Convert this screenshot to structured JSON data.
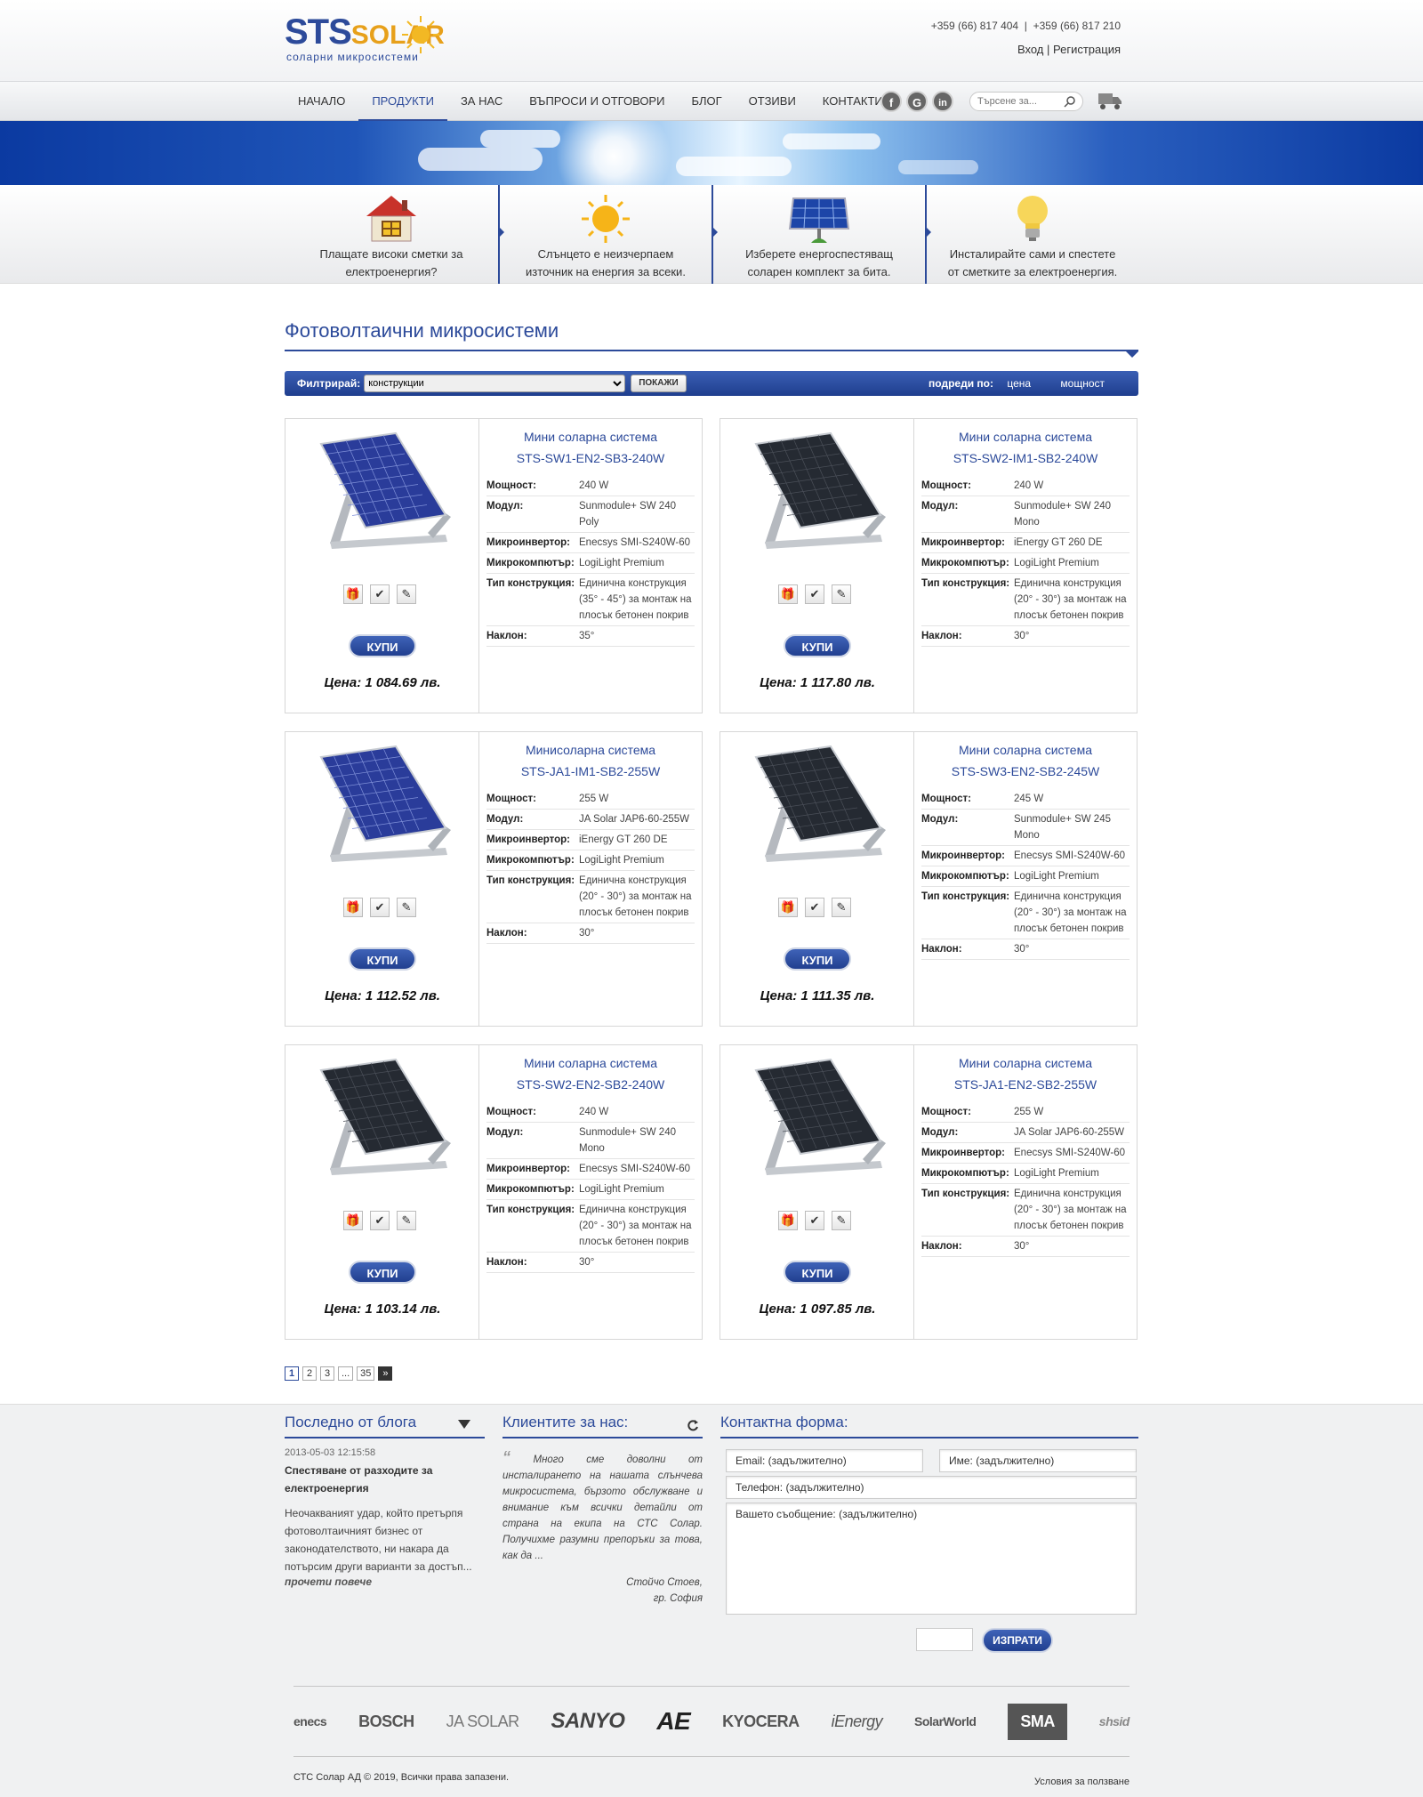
{
  "header": {
    "logo_main": "STS",
    "logo_accent": "SOLAR",
    "logo_sub": "соларни микросистеми",
    "phone1": "+359 (66) 817 404",
    "phone_sep": "|",
    "phone2": "+359 (66) 817 210",
    "login": "Вход",
    "auth_sep": "|",
    "register": "Регистрация"
  },
  "nav": {
    "items": [
      {
        "label": "НАЧАЛО"
      },
      {
        "label": "ПРОДУКТИ"
      },
      {
        "label": "ЗА НАС"
      },
      {
        "label": "ВЪПРОСИ И ОТГОВОРИ"
      },
      {
        "label": "БЛОГ"
      },
      {
        "label": "ОТЗИВИ"
      },
      {
        "label": "КОНТАКТИ"
      }
    ],
    "active_index": 1,
    "social": [
      "f",
      "G",
      "in"
    ],
    "search_placeholder": "Търсене за..."
  },
  "features": [
    {
      "icon": "house-icon",
      "text": "Плащате високи сметки за електроенергия?"
    },
    {
      "icon": "sun-icon",
      "text": "Слънцето е неизчерпаем източник на енергия за всеки."
    },
    {
      "icon": "solar-panel-icon",
      "text": "Изберете енергоспестяващ соларен комплект за бита."
    },
    {
      "icon": "lightbulb-icon",
      "text": "Инсталирайте сами и спестете от сметките за електроенергия."
    }
  ],
  "main": {
    "title": "Фотоволтаични микросистеми",
    "filter_label": "Филтрирай:",
    "filter_value": "конструкции",
    "show_button": "покажи",
    "sort_label": "подреди по:",
    "sort_price": "цена",
    "sort_power": "мощност"
  },
  "spec_keys": {
    "power": "Мощност:",
    "module": "Модул:",
    "inverter": "Микроинвертор:",
    "computer": "Микрокомпютър:",
    "construction": "Тип конструкция:",
    "tilt": "Наклон:"
  },
  "buy_label": "КУПИ",
  "products": [
    {
      "title": "Мини соларна система",
      "code": "STS-SW1-EN2-SB3-240W",
      "power": "240 W",
      "module": "Sunmodule+ SW 240 Poly",
      "inverter": "Enecsys SMI-S240W-60",
      "computer": "LogiLight Premium",
      "construction": "Единична конструкция (35° - 45°) за монтаж на плосък бетонен покрив",
      "tilt": "35°",
      "price": "Цена: 1 084.69 лв.",
      "panel": "poly"
    },
    {
      "title": "Мини соларна система",
      "code": "STS-SW2-IM1-SB2-240W",
      "power": "240 W",
      "module": "Sunmodule+ SW 240 Mono",
      "inverter": "iEnergy GT 260 DE",
      "computer": "LogiLight Premium",
      "construction": "Единична конструкция (20° - 30°) за монтаж на плосък бетонен покрив",
      "tilt": "30°",
      "price": "Цена: 1 117.80 лв.",
      "panel": "mono"
    },
    {
      "title": "Минисоларна система",
      "code": "STS-JA1-IM1-SB2-255W",
      "power": "255 W",
      "module": "JA Solar JAP6-60-255W",
      "inverter": "iEnergy GT 260 DE",
      "computer": "LogiLight Premium",
      "construction": "Единична конструкция (20° - 30°) за монтаж на плосък бетонен покрив",
      "tilt": "30°",
      "price": "Цена: 1 112.52 лв.",
      "panel": "poly"
    },
    {
      "title": "Мини соларна система",
      "code": "STS-SW3-EN2-SB2-245W",
      "power": "245 W",
      "module": "Sunmodule+ SW 245 Mono",
      "inverter": "Enecsys SMI-S240W-60",
      "computer": "LogiLight Premium",
      "construction": "Единична конструкция (20° - 30°) за монтаж на плосък бетонен покрив",
      "tilt": "30°",
      "price": "Цена: 1 111.35 лв.",
      "panel": "mono"
    },
    {
      "title": "Мини соларна система",
      "code": "STS-SW2-EN2-SB2-240W",
      "power": "240 W",
      "module": "Sunmodule+ SW 240 Mono",
      "inverter": "Enecsys SMI-S240W-60",
      "computer": "LogiLight Premium",
      "construction": "Единична конструкция (20° - 30°) за монтаж на плосък бетонен покрив",
      "tilt": "30°",
      "price": "Цена: 1 103.14 лв.",
      "panel": "mono"
    },
    {
      "title": "Мини соларна система",
      "code": "STS-JA1-EN2-SB2-255W",
      "power": "255 W",
      "module": "JA Solar JAP6-60-255W",
      "inverter": "Enecsys SMI-S240W-60",
      "computer": "LogiLight Premium",
      "construction": "Единична конструкция (20° - 30°) за монтаж на плосък бетонен покрив",
      "tilt": "30°",
      "price": "Цена: 1 097.85 лв.",
      "panel": "mono"
    }
  ],
  "pagination": [
    "1",
    "2",
    "3",
    "...",
    "35",
    "»"
  ],
  "footer": {
    "blog_title": "Последно от блога",
    "blog_date": "2013-05-03 12:15:58",
    "blog_post_title": "Спестяване от разходите за електроенергия",
    "blog_excerpt": "Неочакваният удар, който претърпя фотоволтаичният бизнес от законодателството, ни накара да потърсим други варианти за достъп...",
    "blog_more": "прочети повече",
    "clients_title": "Клиентите за нас:",
    "client_quote": "Много сме доволни от инсталирането на нашата слънчева микросистема, бързото обслужване и внимание към всички детайли от страна на екипа на СТС Солар. Получихме разумни препоръки за това, как да ...",
    "client_name": "Стойчо Стоев,",
    "client_city": "гр. София",
    "contact_title": "Контактна форма:",
    "email_ph": "Email: (задължително)",
    "name_ph": "Име: (задължително)",
    "phone_ph": "Телефон: (задължително)",
    "message_ph": "Вашето съобщение: (задължително)",
    "send": "ИЗПРАТИ",
    "partners": [
      "enecs",
      "BOSCH",
      "JA SOLAR",
      "SANYO",
      "AE",
      "KYOCERA",
      "iEnergy",
      "SolarWorld",
      "SMA",
      "shsid"
    ],
    "copyright": "СТС Солар АД © 2019, Всички права запазени.",
    "terms": "Условия за ползване"
  }
}
